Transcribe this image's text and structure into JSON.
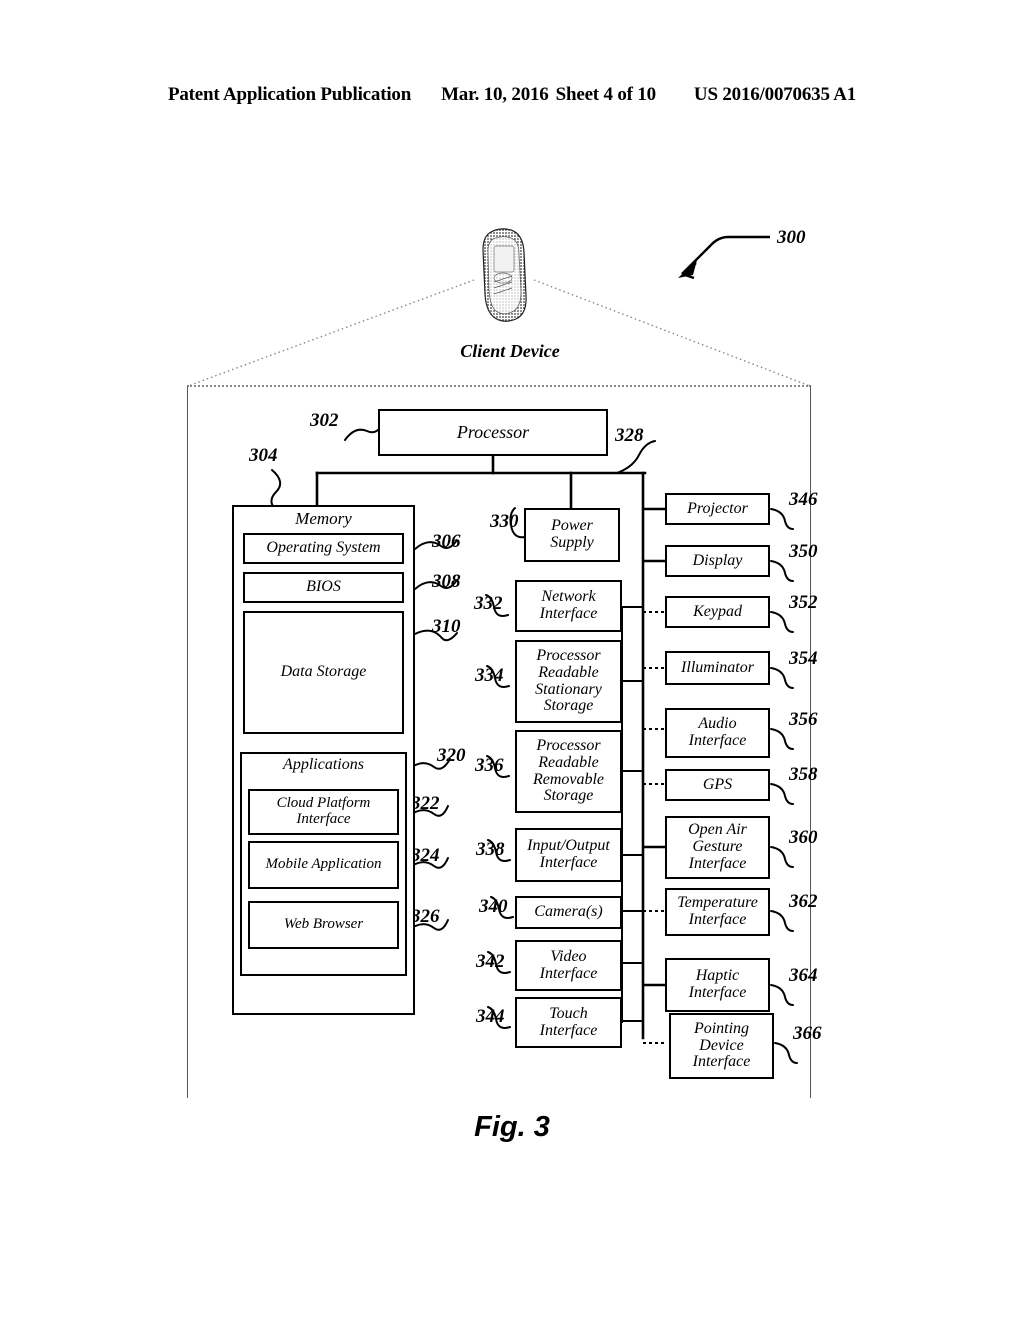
{
  "header": {
    "publication": "Patent Application Publication",
    "date": "Mar. 10, 2016",
    "sheet": "Sheet 4 of 10",
    "patent_number": "US 2016/0070635 A1"
  },
  "figure": {
    "caption": "Fig. 3",
    "system_ref": "300",
    "device_label": "Client Device"
  },
  "blocks": {
    "processor": {
      "label": "Processor",
      "ref": "302"
    },
    "memory": {
      "label": "Memory",
      "ref": "304"
    },
    "operating_system": {
      "label": "Operating System",
      "ref": "306"
    },
    "bios": {
      "label": "BIOS",
      "ref": "308"
    },
    "data_storage": {
      "label": "Data Storage",
      "ref": "310"
    },
    "applications": {
      "label": "Applications",
      "ref": "320"
    },
    "cloud_platform_interface": {
      "label": "Cloud Platform Interface",
      "ref": "322"
    },
    "mobile_application": {
      "label": "Mobile Application",
      "ref": "324"
    },
    "web_browser": {
      "label": "Web Browser",
      "ref": "326"
    },
    "bus": {
      "ref": "328"
    },
    "power_supply": {
      "label": "Power Supply",
      "ref": "330"
    },
    "network_interface": {
      "label": "Network Interface",
      "ref": "332"
    },
    "processor_readable_stationary_storage": {
      "label": "Processor Readable Stationary Storage",
      "ref": "334"
    },
    "processor_readable_removable_storage": {
      "label": "Processor Readable Removable Storage",
      "ref": "336"
    },
    "input_output_interface": {
      "label": "Input/Output Interface",
      "ref": "338"
    },
    "cameras": {
      "label": "Camera(s)",
      "ref": "340"
    },
    "video_interface": {
      "label": "Video Interface",
      "ref": "342"
    },
    "touch_interface": {
      "label": "Touch Interface",
      "ref": "344"
    },
    "projector": {
      "label": "Projector",
      "ref": "346"
    },
    "display": {
      "label": "Display",
      "ref": "350"
    },
    "keypad": {
      "label": "Keypad",
      "ref": "352"
    },
    "illuminator": {
      "label": "Illuminator",
      "ref": "354"
    },
    "audio_interface": {
      "label": "Audio Interface",
      "ref": "356"
    },
    "gps": {
      "label": "GPS",
      "ref": "358"
    },
    "open_air_gesture_interface": {
      "label": "Open Air Gesture Interface",
      "ref": "360"
    },
    "temperature_interface": {
      "label": "Temperature Interface",
      "ref": "362"
    },
    "haptic_interface": {
      "label": "Haptic Interface",
      "ref": "364"
    },
    "pointing_device_interface": {
      "label": "Pointing Device Interface",
      "ref": "366"
    }
  },
  "colors": {
    "ink": "#000000",
    "paper": "#ffffff",
    "dotted": "#888888"
  }
}
